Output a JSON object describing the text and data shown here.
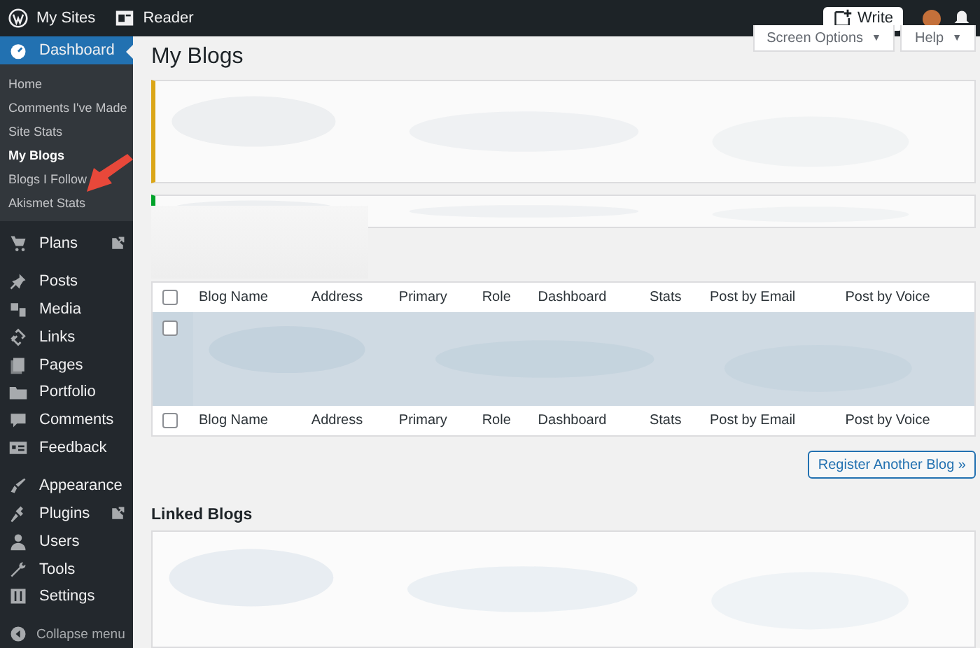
{
  "top_bar": {
    "items": [
      {
        "label": "My Sites"
      },
      {
        "label": "Reader"
      }
    ],
    "write_button": "Write"
  },
  "sidebar": {
    "items": [
      {
        "label": "Dashboard",
        "selected": true,
        "children": [
          {
            "label": "Home",
            "selected": false
          },
          {
            "label": "Comments I've Made",
            "selected": false
          },
          {
            "label": "Site Stats",
            "selected": false
          },
          {
            "label": "My Blogs",
            "selected": true
          },
          {
            "label": "Blogs I Follow",
            "selected": false
          },
          {
            "label": "Akismet Stats",
            "selected": false
          }
        ]
      },
      {
        "label": "Plans",
        "selected": false,
        "external": true
      },
      {
        "label": "Posts",
        "selected": false
      },
      {
        "label": "Media",
        "selected": false
      },
      {
        "label": "Links",
        "selected": false
      },
      {
        "label": "Pages",
        "selected": false
      },
      {
        "label": "Portfolio",
        "selected": false
      },
      {
        "label": "Comments",
        "selected": false
      },
      {
        "label": "Feedback",
        "selected": false
      },
      {
        "label": "Appearance",
        "selected": false
      },
      {
        "label": "Plugins",
        "selected": false,
        "external": true
      },
      {
        "label": "Users",
        "selected": false
      },
      {
        "label": "Tools",
        "selected": false
      },
      {
        "label": "Settings",
        "selected": false
      }
    ],
    "collapse": "Collapse menu"
  },
  "main": {
    "title": "My Blogs",
    "screen_options": "Screen Options",
    "screen_options_caret": "▼",
    "help": "Help",
    "help_caret": "▼",
    "notices": [
      {
        "kind": "warning"
      },
      {
        "kind": "success"
      }
    ],
    "table": {
      "columns": [
        "Blog Name",
        "Address",
        "Primary",
        "Role",
        "Dashboard",
        "Stats",
        "Post by Email",
        "Post by Voice"
      ],
      "footer_columns": [
        "Blog Name",
        "Address",
        "Primary",
        "Role",
        "Dashboard",
        "Stats",
        "Post by Email",
        "Post by Voice"
      ],
      "header_checked": false,
      "footer_checked": false,
      "rows": [
        {
          "checked": false
        }
      ]
    },
    "register_button": "Register Another Blog »",
    "linked_blogs": {
      "title": "Linked Blogs"
    }
  }
}
